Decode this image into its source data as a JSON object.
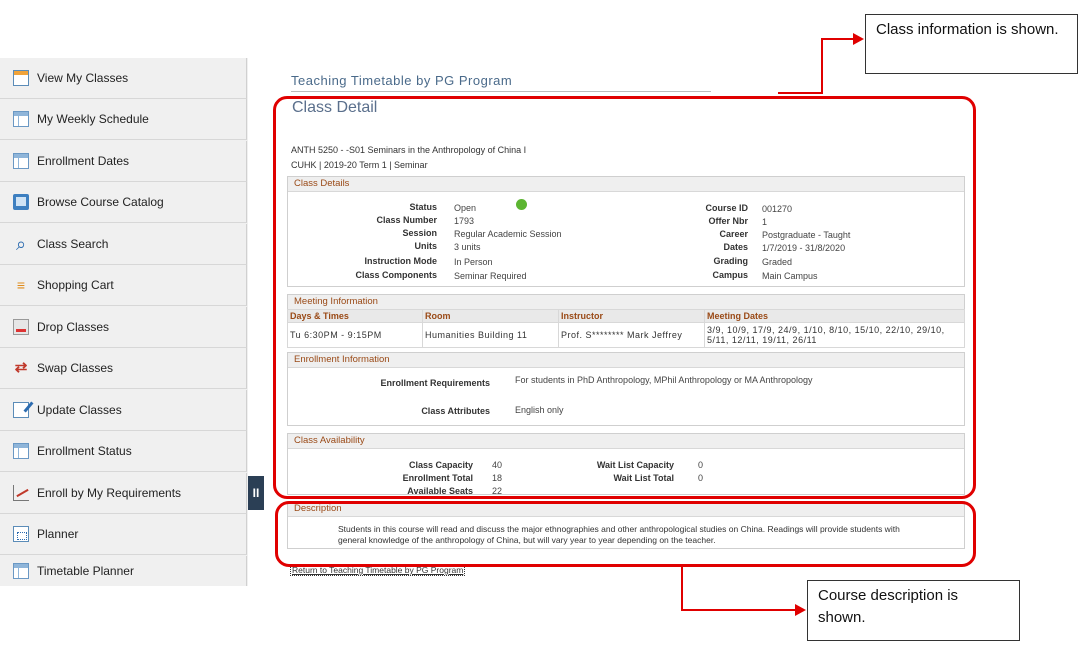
{
  "sidebar": {
    "items": [
      {
        "label": "View My Classes",
        "icon": "calendar-icon"
      },
      {
        "label": "My Weekly Schedule",
        "icon": "window-icon"
      },
      {
        "label": "Enrollment Dates",
        "icon": "window-icon"
      },
      {
        "label": "Browse Course Catalog",
        "icon": "book-icon"
      },
      {
        "label": "Class Search",
        "icon": "search-icon"
      },
      {
        "label": "Shopping Cart",
        "icon": "cart-icon"
      },
      {
        "label": "Drop Classes",
        "icon": "drop-icon"
      },
      {
        "label": "Swap Classes",
        "icon": "swap-icon"
      },
      {
        "label": "Update Classes",
        "icon": "edit-icon"
      },
      {
        "label": "Enrollment Status",
        "icon": "window-icon"
      },
      {
        "label": "Enroll by My Requirements",
        "icon": "chart-icon"
      },
      {
        "label": "Planner",
        "icon": "planner-icon"
      },
      {
        "label": "Timetable Planner",
        "icon": "window-icon"
      }
    ],
    "collapse_label": "II"
  },
  "main": {
    "page_title": "Teaching Timetable by PG Program",
    "heading": "Class Detail",
    "course_line1": "ANTH 5250 - -S01   Seminars in the Anthropology of China I",
    "course_line2": "CUHK | 2019-20 Term 1 | Seminar",
    "class_details": {
      "header": "Class Details",
      "left": [
        {
          "key": "Status",
          "value": "Open"
        },
        {
          "key": "Class Number",
          "value": "1793"
        },
        {
          "key": "Session",
          "value": "Regular Academic Session"
        },
        {
          "key": "Units",
          "value": "3 units"
        },
        {
          "key": "Instruction Mode",
          "value": "In Person"
        },
        {
          "key": "Class Components",
          "value": "Seminar Required"
        }
      ],
      "right": [
        {
          "key": "Course ID",
          "value": "001270"
        },
        {
          "key": "Offer Nbr",
          "value": "1"
        },
        {
          "key": "Career",
          "value": "Postgraduate - Taught"
        },
        {
          "key": "Dates",
          "value": "1/7/2019 - 31/8/2020"
        },
        {
          "key": "Grading",
          "value": "Graded"
        },
        {
          "key": "Campus",
          "value": "Main Campus"
        }
      ],
      "status_color": "#5cb531"
    },
    "meeting": {
      "header": "Meeting Information",
      "columns": [
        "Days & Times",
        "Room",
        "Instructor",
        "Meeting Dates"
      ],
      "row": [
        "Tu 6:30PM - 9:15PM",
        "Humanities Building 11",
        "Prof. S******** Mark Jeffrey",
        "3/9, 10/9, 17/9, 24/9, 1/10, 8/10, 15/10, 22/10, 29/10, 5/11, 12/11, 19/11, 26/11"
      ]
    },
    "enrollment": {
      "header": "Enrollment Information",
      "req_key": "Enrollment Requirements",
      "req_value": "For students in PhD Anthropology, MPhil Anthropology or MA Anthropology",
      "attr_key": "Class Attributes",
      "attr_value": "English only"
    },
    "availability": {
      "header": "Class Availability",
      "left": [
        {
          "key": "Class Capacity",
          "value": "40"
        },
        {
          "key": "Enrollment Total",
          "value": "18"
        },
        {
          "key": "Available Seats",
          "value": "22"
        }
      ],
      "right": [
        {
          "key": "Wait List Capacity",
          "value": "0"
        },
        {
          "key": "Wait List Total",
          "value": "0"
        }
      ]
    },
    "description": {
      "header": "Description",
      "text": "Students in this course will read and discuss the major ethnographies and other anthropological studies on China. Readings will provide students with general knowledge of the anthropology of China, but will vary year to year depending on the teacher."
    },
    "return_link": "Return to Teaching Timetable by PG Program"
  },
  "annotations": {
    "top_callout": "Class information is shown.",
    "bottom_callout": "Course description is shown.",
    "accent": "#e00000"
  }
}
